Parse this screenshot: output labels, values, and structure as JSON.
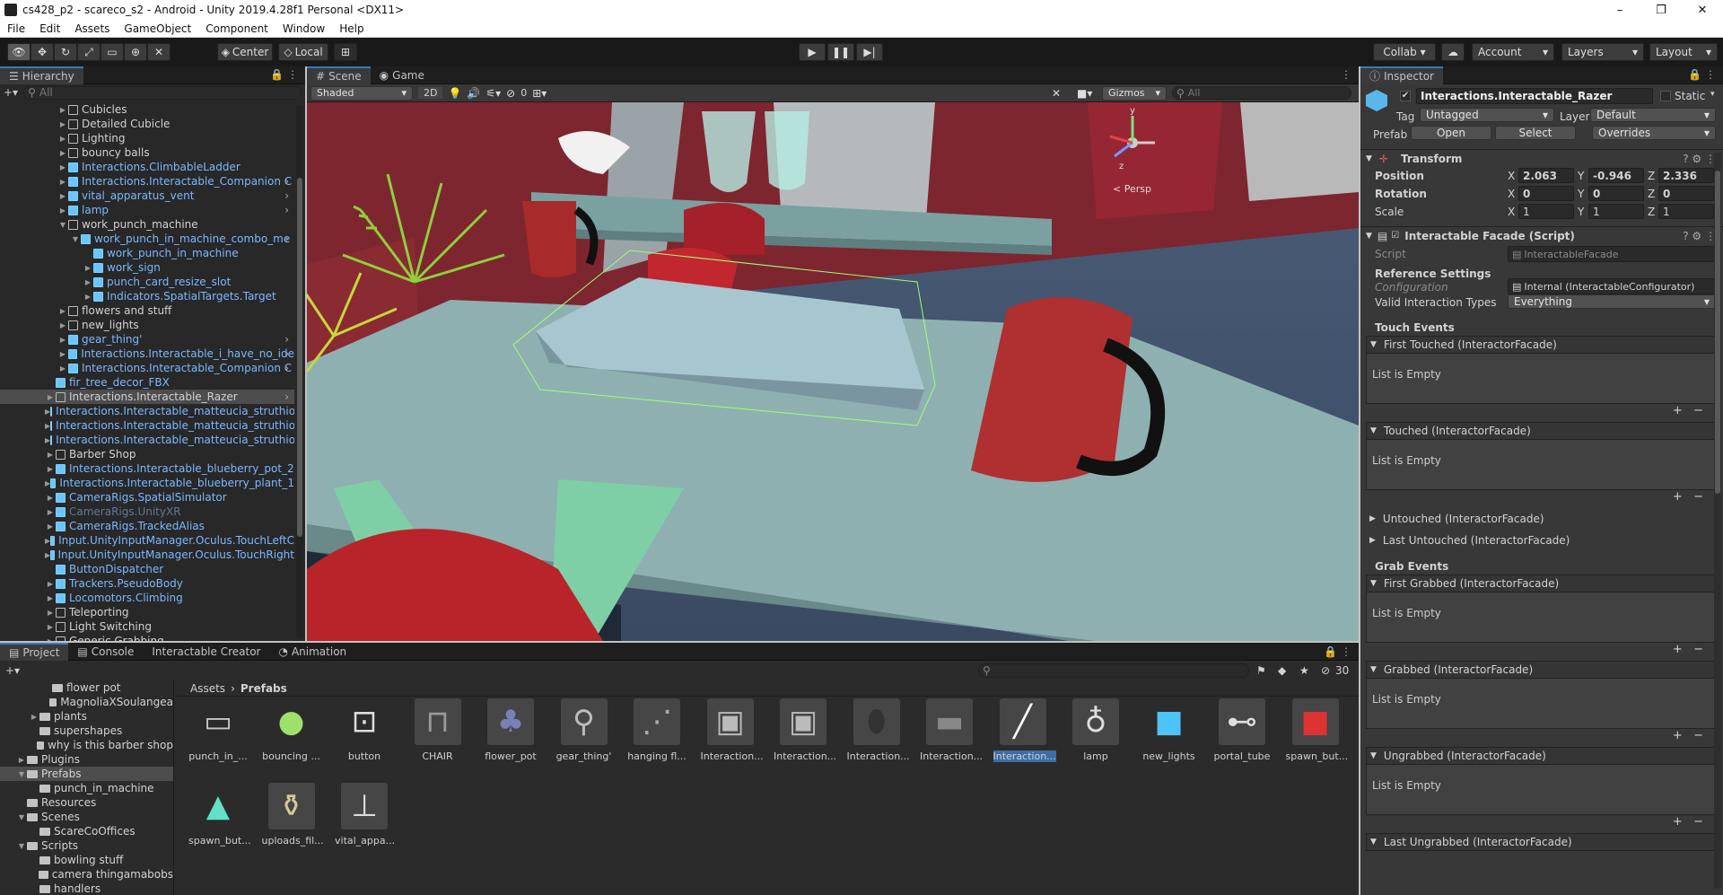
{
  "window": {
    "title": "cs428_p2 - scareco_s2 - Android - Unity 2019.4.28f1 Personal <DX11>",
    "controls": [
      "–",
      "❐",
      "✕"
    ]
  },
  "menu": [
    "File",
    "Edit",
    "Assets",
    "GameObject",
    "Component",
    "Window",
    "Help"
  ],
  "toolbar": {
    "center_label": "Center",
    "local_label": "Local",
    "collab_label": "Collab ▾",
    "account_label": "Account",
    "layers_label": "Layers",
    "layout_label": "Layout"
  },
  "hierarchy": {
    "tab": "Hierarchy",
    "search_placeholder": "All",
    "items": [
      {
        "label": "Cubicles",
        "indent": 2,
        "prefab": false,
        "fold": "closed"
      },
      {
        "label": "Detailed Cubicle",
        "indent": 2,
        "prefab": false,
        "fold": "closed"
      },
      {
        "label": "Lighting",
        "indent": 2,
        "prefab": false,
        "fold": "closed"
      },
      {
        "label": "bouncy balls",
        "indent": 2,
        "prefab": false,
        "fold": "closed"
      },
      {
        "label": "Interactions.ClimbableLadder",
        "indent": 2,
        "prefab": true,
        "fold": "closed"
      },
      {
        "label": "Interactions.Interactable_Companion C",
        "indent": 2,
        "prefab": true,
        "fold": "closed",
        "more": true
      },
      {
        "label": "vital_apparatus_vent",
        "indent": 2,
        "prefab": true,
        "fold": "closed",
        "more": true
      },
      {
        "label": "lamp",
        "indent": 2,
        "prefab": true,
        "fold": "closed",
        "more": true
      },
      {
        "label": "work_punch_machine",
        "indent": 2,
        "prefab": false,
        "fold": "open"
      },
      {
        "label": "work_punch_in_machine_combo_me",
        "indent": 3,
        "prefab": true,
        "fold": "open",
        "more": true
      },
      {
        "label": "work_punch_in_machine",
        "indent": 4,
        "prefab": true,
        "fold": "none"
      },
      {
        "label": "work_sign",
        "indent": 4,
        "prefab": true,
        "fold": "closed"
      },
      {
        "label": "punch_card_resize_slot",
        "indent": 4,
        "prefab": true,
        "fold": "closed"
      },
      {
        "label": "Indicators.SpatialTargets.Target",
        "indent": 4,
        "prefab": true,
        "fold": "closed"
      },
      {
        "label": "flowers and stuff",
        "indent": 2,
        "prefab": false,
        "fold": "closed"
      },
      {
        "label": "new_lights",
        "indent": 2,
        "prefab": false,
        "fold": "closed"
      },
      {
        "label": "gear_thing'",
        "indent": 2,
        "prefab": true,
        "fold": "closed",
        "more": true
      },
      {
        "label": "Interactions.Interactable_i_have_no_ide",
        "indent": 2,
        "prefab": true,
        "fold": "closed",
        "more": true
      },
      {
        "label": "Interactions.Interactable_Companion C",
        "indent": 2,
        "prefab": true,
        "fold": "closed",
        "more": true
      },
      {
        "label": "fir_tree_decor_FBX",
        "indent": 1,
        "prefab": true,
        "fold": "none"
      },
      {
        "label": "Interactions.Interactable_Razer",
        "indent": 1,
        "prefab": false,
        "fold": "closed",
        "more": true,
        "selected": true
      },
      {
        "label": "Interactions.Interactable_matteucia_struthiop",
        "indent": 1,
        "prefab": true,
        "fold": "closed"
      },
      {
        "label": "Interactions.Interactable_matteucia_struthiop",
        "indent": 1,
        "prefab": true,
        "fold": "closed"
      },
      {
        "label": "Interactions.Interactable_matteucia_struthiop",
        "indent": 1,
        "prefab": true,
        "fold": "closed"
      },
      {
        "label": "Barber Shop",
        "indent": 1,
        "prefab": false,
        "fold": "closed"
      },
      {
        "label": "Interactions.Interactable_blueberry_pot_2",
        "indent": 1,
        "prefab": true,
        "fold": "closed"
      },
      {
        "label": "Interactions.Interactable_blueberry_plant_1",
        "indent": 1,
        "prefab": true,
        "fold": "closed"
      },
      {
        "label": "CameraRigs.SpatialSimulator",
        "indent": 1,
        "prefab": true,
        "fold": "closed"
      },
      {
        "label": "CameraRigs.UnityXR",
        "indent": 1,
        "prefab": true,
        "fold": "closed",
        "dim": true
      },
      {
        "label": "CameraRigs.TrackedAlias",
        "indent": 1,
        "prefab": true,
        "fold": "closed"
      },
      {
        "label": "Input.UnityInputManager.Oculus.TouchLeftC",
        "indent": 1,
        "prefab": true,
        "fold": "closed"
      },
      {
        "label": "Input.UnityInputManager.Oculus.TouchRight",
        "indent": 1,
        "prefab": true,
        "fold": "closed"
      },
      {
        "label": "ButtonDispatcher",
        "indent": 1,
        "prefab": true,
        "fold": "none"
      },
      {
        "label": "Trackers.PseudoBody",
        "indent": 1,
        "prefab": true,
        "fold": "closed"
      },
      {
        "label": "Locomotors.Climbing",
        "indent": 1,
        "prefab": true,
        "fold": "closed"
      },
      {
        "label": "Teleporting",
        "indent": 1,
        "prefab": false,
        "fold": "closed"
      },
      {
        "label": "Light Switching",
        "indent": 1,
        "prefab": false,
        "fold": "closed"
      },
      {
        "label": "Generic Grabbing",
        "indent": 1,
        "prefab": false,
        "fold": "closed"
      }
    ]
  },
  "scene": {
    "tabs": [
      "Scene",
      "Game"
    ],
    "shading": "Shaded",
    "mode_2d": "2D",
    "fx_count": "0",
    "gizmos": "Gizmos",
    "search_placeholder": "All",
    "persp_label": "< Persp",
    "axis_y": "y",
    "axis_z": "z"
  },
  "inspector": {
    "tab": "Inspector",
    "object_name": "Interactions.Interactable_Razer",
    "static_label": "Static",
    "tag_label": "Tag",
    "tag_value": "Untagged",
    "layer_label": "Layer",
    "layer_value": "Default",
    "prefab_label": "Prefab",
    "open_label": "Open",
    "select_label": "Select",
    "overrides_label": "Overrides",
    "transform": {
      "title": "Transform",
      "position_label": "Position",
      "rotation_label": "Rotation",
      "scale_label": "Scale",
      "position": {
        "x": "2.063",
        "y": "-0.946",
        "z": "2.336"
      },
      "rotation": {
        "x": "0",
        "y": "0",
        "z": "0"
      },
      "scale": {
        "x": "1",
        "y": "1",
        "z": "1"
      }
    },
    "script_component": {
      "title": "Interactable Facade (Script)",
      "script_label": "Script",
      "script_value": "InteractableFacade",
      "ref_settings": "Reference Settings",
      "config_label": "Configuration",
      "config_value": "Internal (InteractableConfigurator)",
      "valid_label": "Valid Interaction Types",
      "valid_value": "Everything",
      "touch_events": "Touch Events",
      "grab_events": "Grab Events",
      "empty_text": "List is Empty",
      "ev_first_touched": "First Touched (InteractorFacade)",
      "ev_touched": "Touched (InteractorFacade)",
      "ev_untouched": "Untouched (InteractorFacade)",
      "ev_last_untouched": "Last Untouched (InteractorFacade)",
      "ev_first_grabbed": "First Grabbed (InteractorFacade)",
      "ev_grabbed": "Grabbed (InteractorFacade)",
      "ev_ungrabbed": "Ungrabbed (InteractorFacade)",
      "ev_last_ungrabbed": "Last Ungrabbed (InteractorFacade)"
    }
  },
  "project": {
    "tabs": [
      "Project",
      "Console",
      "Interactable Creator",
      "Animation"
    ],
    "breadcrumb": [
      "Assets",
      "Prefabs"
    ],
    "hidden_count": "30",
    "folders": [
      {
        "label": "flower pot",
        "indent": 3
      },
      {
        "label": "MagnoliaXSoulangea",
        "indent": 3
      },
      {
        "label": "plants",
        "indent": 2,
        "fold": true
      },
      {
        "label": "supershapes",
        "indent": 2
      },
      {
        "label": "why is this barber shop",
        "indent": 2
      },
      {
        "label": "Plugins",
        "indent": 1,
        "fold": true
      },
      {
        "label": "Prefabs",
        "indent": 1,
        "fold": true,
        "selected": true
      },
      {
        "label": "punch_in_machine",
        "indent": 2
      },
      {
        "label": "Resources",
        "indent": 1
      },
      {
        "label": "Scenes",
        "indent": 1,
        "fold": true
      },
      {
        "label": "ScareCoOffices",
        "indent": 2
      },
      {
        "label": "Scripts",
        "indent": 1,
        "fold": true
      },
      {
        "label": "bowling stuff",
        "indent": 2
      },
      {
        "label": "camera thingamabobs",
        "indent": 2
      },
      {
        "label": "handlers",
        "indent": 2
      }
    ],
    "assets": [
      {
        "label": "punch_in_...",
        "icon": "folder-icon"
      },
      {
        "label": "bouncing ...",
        "icon": "ball-icon"
      },
      {
        "label": "button",
        "icon": "button-icon"
      },
      {
        "label": "CHAIR",
        "icon": "chair-icon"
      },
      {
        "label": "flower_pot",
        "icon": "flower-pot-icon"
      },
      {
        "label": "gear_thing'",
        "icon": "gear-thing-icon"
      },
      {
        "label": "hanging fl...",
        "icon": "hanging-icon"
      },
      {
        "label": "Interaction...",
        "icon": "companion-cube-icon"
      },
      {
        "label": "Interaction...",
        "icon": "companion-cube-icon"
      },
      {
        "label": "Interaction...",
        "icon": "egg-icon"
      },
      {
        "label": "Interaction...",
        "icon": "flat-icon"
      },
      {
        "label": "Interaction...",
        "icon": "razer-icon",
        "selected": true
      },
      {
        "label": "lamp",
        "icon": "lamp-icon"
      },
      {
        "label": "new_lights",
        "icon": "blue-cube-icon"
      },
      {
        "label": "portal_tube",
        "icon": "tube-icon"
      },
      {
        "label": "spawn_but...",
        "icon": "spawn-button-icon"
      },
      {
        "label": "spawn_but...",
        "icon": "triangle-icon"
      },
      {
        "label": "uploads_fil...",
        "icon": "vase-icon"
      },
      {
        "label": "vital_appa...",
        "icon": "vent-icon"
      }
    ]
  }
}
